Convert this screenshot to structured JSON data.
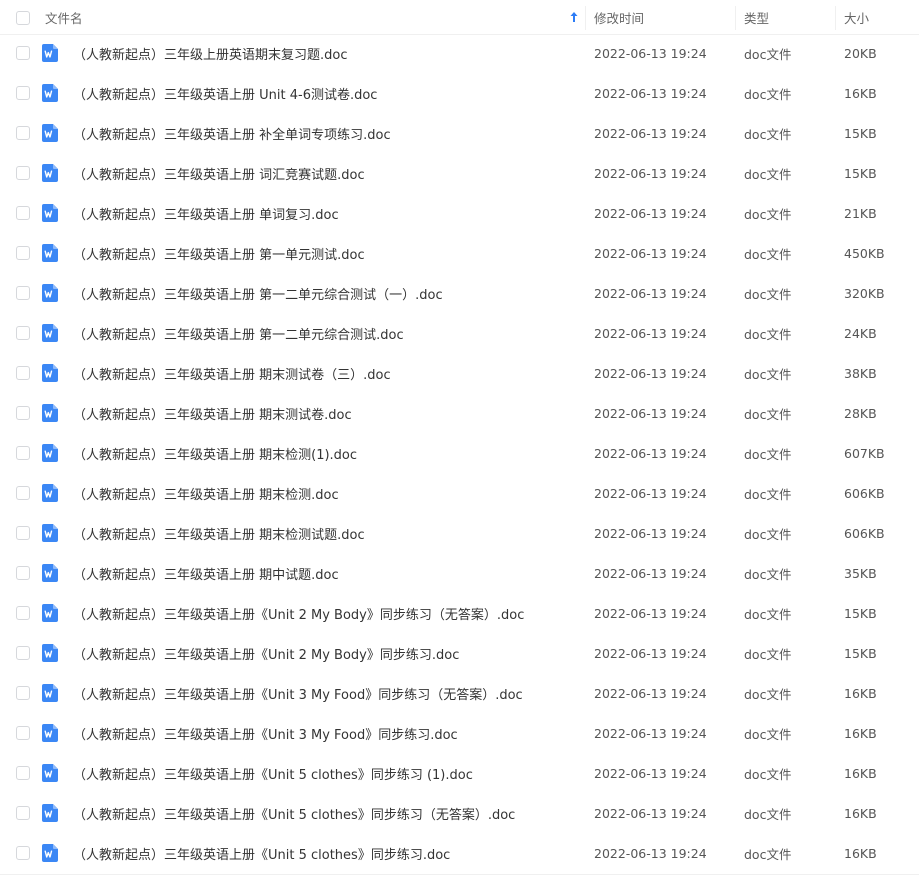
{
  "header": {
    "name_label": "文件名",
    "mtime_label": "修改时间",
    "type_label": "类型",
    "size_label": "大小"
  },
  "colors": {
    "accent": "#2c7cf6",
    "doc_icon": "#3b87f5"
  },
  "files": [
    {
      "name": "（人教新起点）三年级上册英语期末复习题.doc",
      "mtime": "2022-06-13 19:24",
      "type": "doc文件",
      "size": "20KB"
    },
    {
      "name": "（人教新起点）三年级英语上册 Unit 4-6测试卷.doc",
      "mtime": "2022-06-13 19:24",
      "type": "doc文件",
      "size": "16KB"
    },
    {
      "name": "（人教新起点）三年级英语上册 补全单词专项练习.doc",
      "mtime": "2022-06-13 19:24",
      "type": "doc文件",
      "size": "15KB"
    },
    {
      "name": "（人教新起点）三年级英语上册 词汇竞赛试题.doc",
      "mtime": "2022-06-13 19:24",
      "type": "doc文件",
      "size": "15KB"
    },
    {
      "name": "（人教新起点）三年级英语上册 单词复习.doc",
      "mtime": "2022-06-13 19:24",
      "type": "doc文件",
      "size": "21KB"
    },
    {
      "name": "（人教新起点）三年级英语上册 第一单元测试.doc",
      "mtime": "2022-06-13 19:24",
      "type": "doc文件",
      "size": "450KB"
    },
    {
      "name": "（人教新起点）三年级英语上册 第一二单元综合测试（一）.doc",
      "mtime": "2022-06-13 19:24",
      "type": "doc文件",
      "size": "320KB"
    },
    {
      "name": "（人教新起点）三年级英语上册 第一二单元综合测试.doc",
      "mtime": "2022-06-13 19:24",
      "type": "doc文件",
      "size": "24KB"
    },
    {
      "name": "（人教新起点）三年级英语上册 期末测试卷（三）.doc",
      "mtime": "2022-06-13 19:24",
      "type": "doc文件",
      "size": "38KB"
    },
    {
      "name": "（人教新起点）三年级英语上册 期末测试卷.doc",
      "mtime": "2022-06-13 19:24",
      "type": "doc文件",
      "size": "28KB"
    },
    {
      "name": "（人教新起点）三年级英语上册 期末检测(1).doc",
      "mtime": "2022-06-13 19:24",
      "type": "doc文件",
      "size": "607KB"
    },
    {
      "name": "（人教新起点）三年级英语上册 期末检测.doc",
      "mtime": "2022-06-13 19:24",
      "type": "doc文件",
      "size": "606KB"
    },
    {
      "name": "（人教新起点）三年级英语上册 期末检测试题.doc",
      "mtime": "2022-06-13 19:24",
      "type": "doc文件",
      "size": "606KB"
    },
    {
      "name": "（人教新起点）三年级英语上册 期中试题.doc",
      "mtime": "2022-06-13 19:24",
      "type": "doc文件",
      "size": "35KB"
    },
    {
      "name": "（人教新起点）三年级英语上册《Unit 2 My Body》同步练习（无答案）.doc",
      "mtime": "2022-06-13 19:24",
      "type": "doc文件",
      "size": "15KB"
    },
    {
      "name": "（人教新起点）三年级英语上册《Unit 2 My Body》同步练习.doc",
      "mtime": "2022-06-13 19:24",
      "type": "doc文件",
      "size": "15KB"
    },
    {
      "name": "（人教新起点）三年级英语上册《Unit 3 My Food》同步练习（无答案）.doc",
      "mtime": "2022-06-13 19:24",
      "type": "doc文件",
      "size": "16KB"
    },
    {
      "name": "（人教新起点）三年级英语上册《Unit 3 My Food》同步练习.doc",
      "mtime": "2022-06-13 19:24",
      "type": "doc文件",
      "size": "16KB"
    },
    {
      "name": "（人教新起点）三年级英语上册《Unit 5 clothes》同步练习 (1).doc",
      "mtime": "2022-06-13 19:24",
      "type": "doc文件",
      "size": "16KB"
    },
    {
      "name": "（人教新起点）三年级英语上册《Unit 5 clothes》同步练习（无答案）.doc",
      "mtime": "2022-06-13 19:24",
      "type": "doc文件",
      "size": "16KB"
    },
    {
      "name": "（人教新起点）三年级英语上册《Unit 5 clothes》同步练习.doc",
      "mtime": "2022-06-13 19:24",
      "type": "doc文件",
      "size": "16KB"
    }
  ]
}
